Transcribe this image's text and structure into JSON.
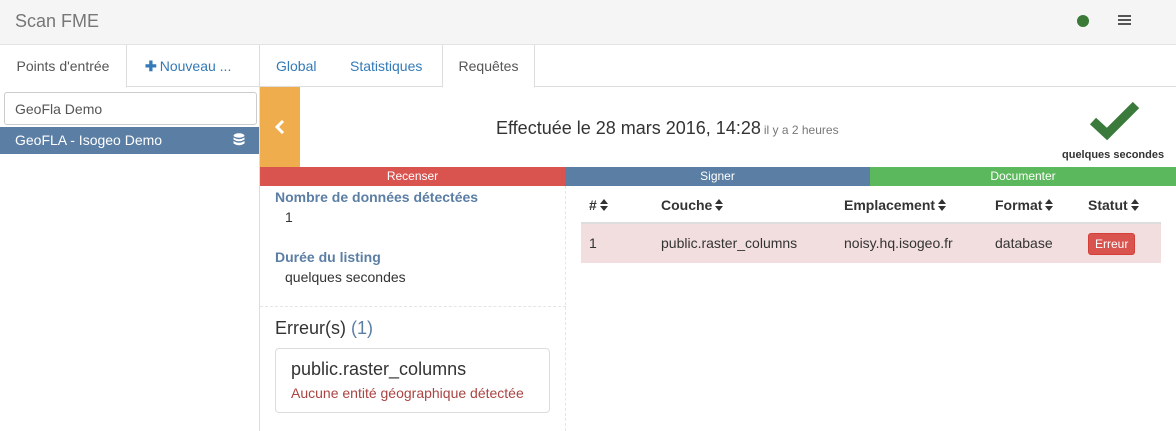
{
  "app": {
    "title": "Scan FME"
  },
  "colors": {
    "status_ok": "#3a7a36",
    "accent": "#5b7ea4",
    "warning": "#f0ad4e",
    "step_recenser": "#d9534f",
    "step_signer": "#5b7ea4",
    "step_documenter": "#5cb85c",
    "success_check": "#3a7a3a"
  },
  "icons": {
    "status": "status-dot-icon",
    "menu": "hamburger-icon",
    "database": "database-icon",
    "back": "chevron-left-icon",
    "success": "check-icon",
    "sort": "sort-icon"
  },
  "sidebar": {
    "tabs": [
      {
        "label": "Points d'entrée"
      },
      {
        "plus": "✚",
        "label": "Nouveau ..."
      }
    ],
    "search": {
      "value": "GeoFla Demo"
    },
    "items": [
      {
        "label": "GeoFLA - Isogeo Demo"
      }
    ]
  },
  "main": {
    "tabs": [
      {
        "label": "Global"
      },
      {
        "label": "Statistiques"
      },
      {
        "label": "Requêtes"
      }
    ],
    "header": {
      "done": "Effectuée le 28 mars 2016, 14:28",
      "ago": "il y a 2 heures",
      "duration_caption": "quelques secondes"
    },
    "steps": [
      {
        "label": "Recenser"
      },
      {
        "label": "Signer"
      },
      {
        "label": "Documenter"
      }
    ],
    "info": {
      "detected_label": "Nombre de données détectées",
      "detected_value": "1",
      "duration_label": "Durée du listing",
      "duration_value": "quelques secondes"
    },
    "errors": {
      "title": "Erreur(s)",
      "count": "(1)",
      "items": [
        {
          "name": "public.raster_columns",
          "message": "Aucune entité géographique détectée"
        }
      ]
    },
    "table": {
      "columns": [
        "#",
        "Couche",
        "Emplacement",
        "Format",
        "Statut"
      ],
      "rows": [
        {
          "num": "1",
          "layer": "public.raster_columns",
          "location": "noisy.hq.isogeo.fr",
          "format": "database",
          "status": "Erreur"
        }
      ]
    }
  }
}
